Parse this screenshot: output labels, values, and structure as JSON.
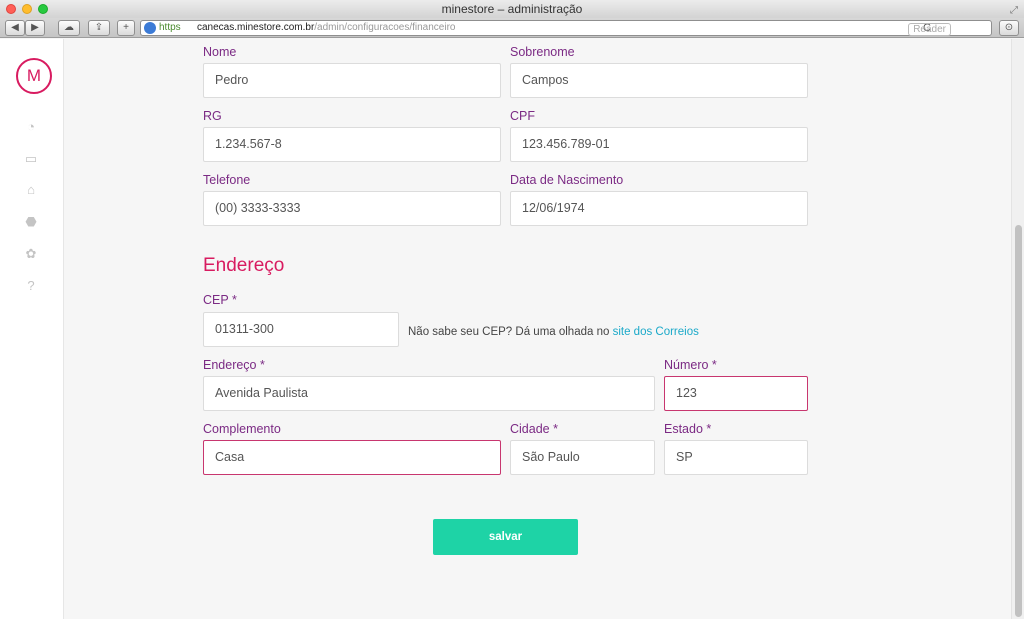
{
  "window": {
    "title": "minestore – administração"
  },
  "browser": {
    "url_scheme": "https",
    "url_host": "canecas.minestore.com.br",
    "url_path": "/admin/configuracoes/financeiro",
    "reader_label": "Reader",
    "buttons": {
      "back": "◀",
      "forward": "▶",
      "icloud": "☁",
      "share": "⇪",
      "new_tab": "+",
      "reload": "C",
      "download": "⊙"
    }
  },
  "sidebar": {
    "logo": "M",
    "icons": [
      "dashboard-icon",
      "inbox-icon",
      "gift-icon",
      "tag-icon",
      "gear-icon",
      "help-icon"
    ],
    "glyphs": [
      "◔",
      "▭",
      "⌂",
      "⬣",
      "✿",
      "?"
    ]
  },
  "form": {
    "nome": {
      "label": "Nome",
      "value": "Pedro"
    },
    "sobrenome": {
      "label": "Sobrenome",
      "value": "Campos"
    },
    "rg": {
      "label": "RG",
      "value": "1.234.567-8"
    },
    "cpf": {
      "label": "CPF",
      "value": "123.456.789-01"
    },
    "telefone": {
      "label": "Telefone",
      "value": "(00) 3333-3333"
    },
    "nascimento": {
      "label": "Data de Nascimento",
      "value": "12/06/1974"
    }
  },
  "address": {
    "title": "Endereço",
    "cep": {
      "label": "CEP *",
      "value": "01311-300"
    },
    "cep_help": "Não sabe seu CEP? Dá uma olhada no ",
    "cep_link": "site dos Correios",
    "endereco": {
      "label": "Endereço *",
      "value": "Avenida Paulista"
    },
    "numero": {
      "label": "Número *",
      "value": "123"
    },
    "complemento": {
      "label": "Complemento",
      "value": "Casa"
    },
    "cidade": {
      "label": "Cidade *",
      "value": "São Paulo"
    },
    "estado": {
      "label": "Estado *",
      "value": "SP"
    }
  },
  "actions": {
    "save_label": "salvar"
  },
  "colors": {
    "accent": "#d81b60",
    "label": "#7b2a84",
    "save": "#1ed3a6",
    "link": "#1ba9c9",
    "error_border": "#c8366f"
  }
}
